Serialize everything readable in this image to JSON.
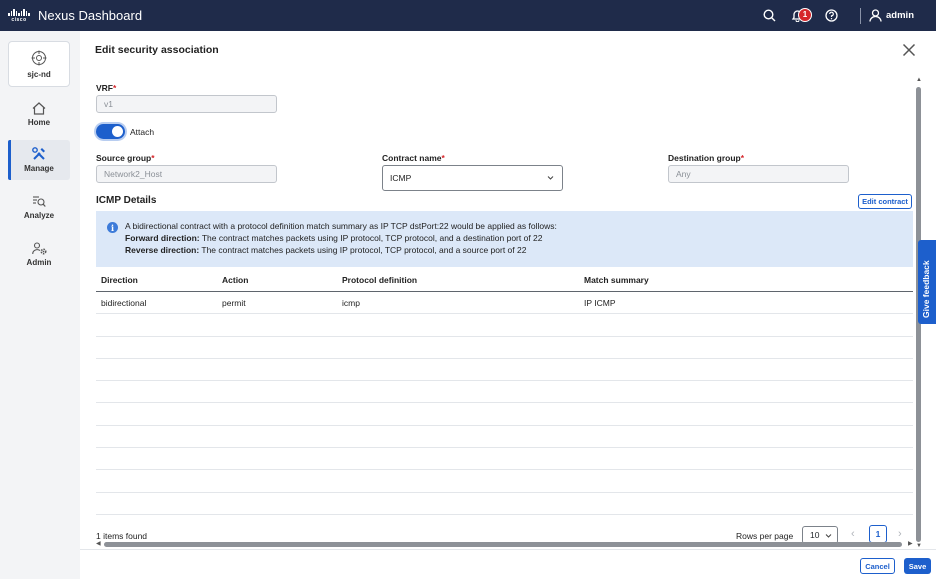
{
  "topbar": {
    "logo_text": "cisco",
    "app_title": "Nexus Dashboard",
    "notification_count": "1",
    "user_name": "admin"
  },
  "leftnav": {
    "site_label": "sjc-nd",
    "items": [
      {
        "label": "Home",
        "icon": "home-icon"
      },
      {
        "label": "Manage",
        "icon": "tools-icon",
        "active": true
      },
      {
        "label": "Analyze",
        "icon": "analyze-icon"
      },
      {
        "label": "Admin",
        "icon": "admin-gear-icon"
      }
    ]
  },
  "panel": {
    "title": "Edit security association",
    "vrf_label": "VRF",
    "vrf_value": "v1",
    "attach_label": "Attach",
    "attach_on": true,
    "source_group_label": "Source group",
    "source_group_value": "Network2_Host",
    "contract_name_label": "Contract name",
    "contract_name_value": "ICMP",
    "destination_group_label": "Destination group",
    "destination_group_placeholder": "Any",
    "section_title": "ICMP Details",
    "edit_contract_label": "Edit contract",
    "info": {
      "line1": "A bidirectional contract with a protocol definition match summary as IP TCP dstPort:22 would be applied as follows:",
      "forward_label": "Forward direction:",
      "forward_text": " The contract matches packets using IP protocol, TCP protocol, and a destination port of 22",
      "reverse_label": "Reverse direction:",
      "reverse_text": " The contract matches packets using IP protocol, TCP protocol, and a source port of 22"
    },
    "table": {
      "headers": [
        "Direction",
        "Action",
        "Protocol definition",
        "Match summary"
      ],
      "rows": [
        [
          "bidirectional",
          "permit",
          "icmp",
          "IP ICMP"
        ]
      ]
    },
    "items_found": "1 items found",
    "rows_per_page_label": "Rows per page",
    "rows_per_page_value": "10",
    "current_page": "1",
    "cancel_label": "Cancel",
    "save_label": "Save"
  },
  "feedback_label": "Give feedback",
  "colors": {
    "topbar": "#1f2b4a",
    "accent": "#1d5fcc",
    "info_bg": "#dce8f8",
    "required": "#d6262b"
  }
}
